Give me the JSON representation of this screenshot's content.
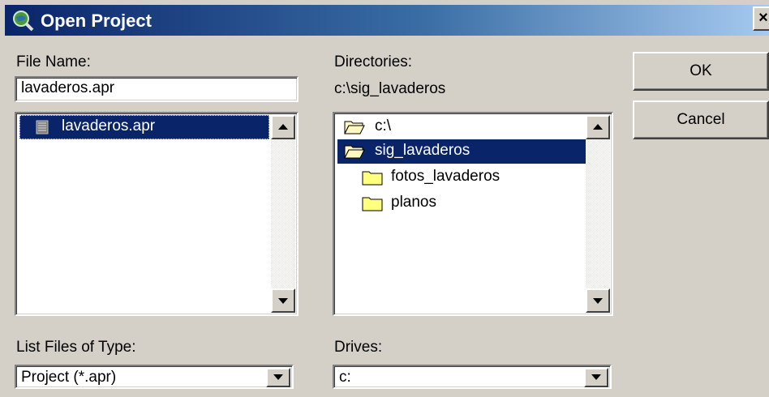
{
  "window": {
    "title": "Open Project",
    "title_icon": "globe-magnifier-icon",
    "close_label": "×"
  },
  "file_name": {
    "label": "File Name:",
    "value": "lavaderos.apr"
  },
  "files": [
    {
      "name": "lavaderos.apr",
      "icon": "document-icon",
      "selected": true
    }
  ],
  "directories": {
    "label": "Directories:",
    "current_path": "c:\\sig_lavaderos",
    "items": [
      {
        "name": "c:\\",
        "icon": "open-folder-icon",
        "selected": false
      },
      {
        "name": "sig_lavaderos",
        "icon": "open-folder-icon",
        "selected": true
      },
      {
        "name": "fotos_lavaderos",
        "icon": "folder-icon",
        "selected": false
      },
      {
        "name": "planos",
        "icon": "folder-icon",
        "selected": false
      }
    ]
  },
  "file_type": {
    "label": "List Files of Type:",
    "selected": "Project (*.apr)"
  },
  "drives": {
    "label": "Drives:",
    "selected": "c:"
  },
  "buttons": {
    "ok": "OK",
    "cancel": "Cancel"
  },
  "colors": {
    "selection": "#0a246a",
    "dialog_bg": "#d4d0c8",
    "title_start": "#0a246a",
    "title_end": "#a6caf0"
  }
}
